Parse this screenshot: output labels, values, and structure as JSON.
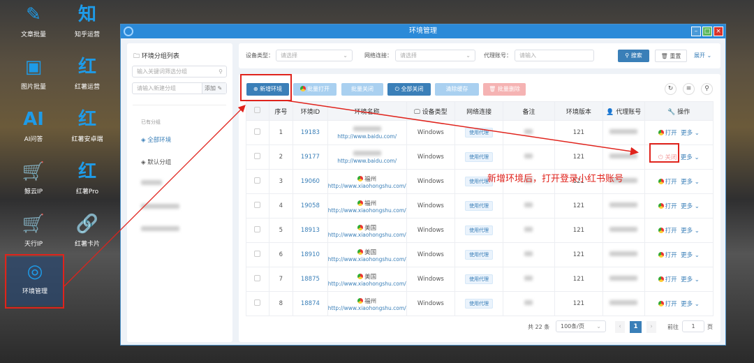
{
  "desktop": {
    "icons": [
      {
        "label": "文章批量",
        "icon": "document-edit-icon",
        "glyph": "✎"
      },
      {
        "label": "知乎运营",
        "icon": "zhihu-icon",
        "glyph": "知"
      },
      {
        "label": "图片批量",
        "icon": "image-edit-icon",
        "glyph": "▣"
      },
      {
        "label": "红薯运营",
        "icon": "hongshu-icon",
        "glyph": "红"
      },
      {
        "label": "AI问答",
        "icon": "ai-head-icon",
        "glyph": "AI"
      },
      {
        "label": "红薯安卓端",
        "icon": "hongshu-icon",
        "glyph": "红"
      },
      {
        "label": "鲸云IP",
        "icon": "cart-icon",
        "glyph": "🛒"
      },
      {
        "label": "红薯Pro",
        "icon": "hongshu-icon",
        "glyph": "红"
      },
      {
        "label": "天行IP",
        "icon": "cart-icon",
        "glyph": "🛒"
      },
      {
        "label": "红薯卡片",
        "icon": "link-icon",
        "glyph": "🔗"
      },
      {
        "label": "环境管理",
        "icon": "chrome-icon",
        "glyph": "◎"
      }
    ]
  },
  "window": {
    "title": "环境管理"
  },
  "sidebar": {
    "title": "环境分组列表",
    "filter_placeholder": "输入关键词筛选分组",
    "new_placeholder": "请输入新建分组",
    "add_label": "添加",
    "section": "已有分组",
    "groups": [
      "全部环境",
      "默认分组"
    ]
  },
  "filters": {
    "device_label": "设备类型：",
    "device_placeholder": "请选择",
    "network_label": "网络连接：",
    "network_placeholder": "请选择",
    "proxy_label": "代理账号：",
    "proxy_placeholder": "请输入",
    "search": "搜索",
    "reset": "重置",
    "expand": "展开"
  },
  "toolbar": {
    "add": "新增环境",
    "batch_open": "批量打开",
    "batch_close": "批量关闭",
    "close_all": "全部关闭",
    "clear_cache": "清除缓存",
    "batch_delete": "批量删除"
  },
  "table": {
    "headers": [
      "序号",
      "环境ID",
      "环境名称",
      "设备类型",
      "网络连接",
      "备注",
      "环境版本",
      "代理账号",
      "操作"
    ],
    "rows": [
      {
        "no": "1",
        "id": "19183",
        "url": "http://www.baidu.com/",
        "device": "Windows",
        "net": "使用代理",
        "ver": "121",
        "action": "打开"
      },
      {
        "no": "2",
        "id": "19177",
        "url": "http://www.baidu.com/",
        "device": "Windows",
        "net": "使用代理",
        "ver": "121",
        "action": "关闭"
      },
      {
        "no": "3",
        "id": "19060",
        "name": "福州",
        "url": "http://www.xiaohongshu.com/",
        "device": "Windows",
        "net": "使用代理",
        "ver": "121",
        "action": "打开"
      },
      {
        "no": "4",
        "id": "19058",
        "name": "福州",
        "url": "http://www.xiaohongshu.com/",
        "device": "Windows",
        "net": "使用代理",
        "ver": "121",
        "action": "打开"
      },
      {
        "no": "5",
        "id": "18913",
        "name": "美国",
        "url": "http://www.xiaohongshu.com/",
        "device": "Windows",
        "net": "使用代理",
        "ver": "121",
        "action": "打开"
      },
      {
        "no": "6",
        "id": "18910",
        "name": "美国",
        "url": "http://www.xiaohongshu.com/",
        "device": "Windows",
        "net": "使用代理",
        "ver": "121",
        "action": "打开"
      },
      {
        "no": "7",
        "id": "18875",
        "name": "美国",
        "url": "http://www.xiaohongshu.com/",
        "device": "Windows",
        "net": "使用代理",
        "ver": "121",
        "action": "打开"
      },
      {
        "no": "8",
        "id": "18874",
        "name": "福州",
        "url": "http://www.xiaohongshu.com/",
        "device": "Windows",
        "net": "使用代理",
        "ver": "121",
        "action": "打开"
      }
    ],
    "more": "更多"
  },
  "pagination": {
    "total": "共 22 条",
    "page_size": "100条/页",
    "current": "1",
    "goto": "前往",
    "goto_value": "1",
    "page_unit": "页"
  },
  "annotation": {
    "text": "新增环境后，打开登录小红书账号",
    "color": "#e0231c"
  }
}
